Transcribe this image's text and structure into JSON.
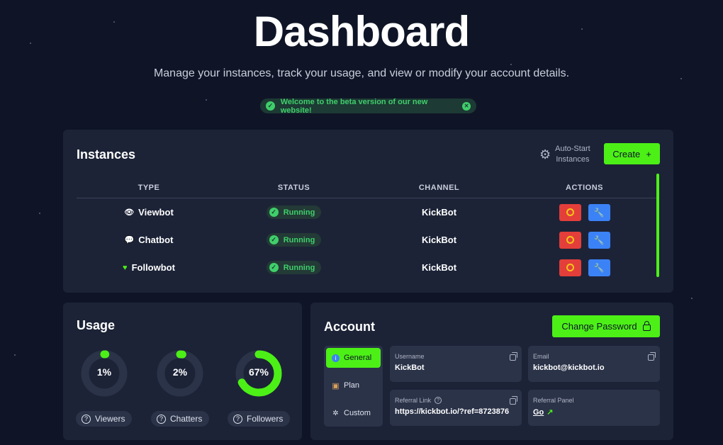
{
  "header": {
    "title": "Dashboard",
    "subtitle": "Manage your instances, track your usage, and view or modify your account details.",
    "banner": "Welcome to the beta version of our new website!"
  },
  "instances": {
    "title": "Instances",
    "auto_start_label_1": "Auto-Start",
    "auto_start_label_2": "Instances",
    "create_label": "Create",
    "columns": [
      "TYPE",
      "STATUS",
      "CHANNEL",
      "ACTIONS"
    ],
    "rows": [
      {
        "type": "Viewbot",
        "type_icon": "eye-icon",
        "status": "Running",
        "channel": "KickBot"
      },
      {
        "type": "Chatbot",
        "type_icon": "chat-icon",
        "status": "Running",
        "channel": "KickBot"
      },
      {
        "type": "Followbot",
        "type_icon": "heart-icon",
        "status": "Running",
        "channel": "KickBot"
      }
    ]
  },
  "usage": {
    "title": "Usage",
    "meters": [
      {
        "label": "1%",
        "value": 0.01,
        "name": "Viewers"
      },
      {
        "label": "2%",
        "value": 0.02,
        "name": "Chatters"
      },
      {
        "label": "67%",
        "value": 0.67,
        "name": "Followers"
      }
    ]
  },
  "account": {
    "title": "Account",
    "change_password_label": "Change Password",
    "nav": [
      {
        "label": "General",
        "icon": "info-icon",
        "active": true
      },
      {
        "label": "Plan",
        "icon": "box-icon",
        "active": false
      },
      {
        "label": "Custom",
        "icon": "sparkle-icon",
        "active": false
      }
    ],
    "fields": {
      "username_label": "Username",
      "username_value": "KickBot",
      "email_label": "Email",
      "email_value": "kickbot@kickbot.io",
      "referral_link_label": "Referral Link",
      "referral_link_value": "https://kickbot.io/?ref=8723876",
      "referral_panel_label": "Referral Panel",
      "referral_panel_value": "Go"
    }
  },
  "colors": {
    "background": "#0f1527",
    "card": "#1c2337",
    "accent_green": "#4cf017",
    "status_green": "#3fcf6a",
    "stop_red": "#e33e3a",
    "edit_blue": "#3b82f6"
  }
}
